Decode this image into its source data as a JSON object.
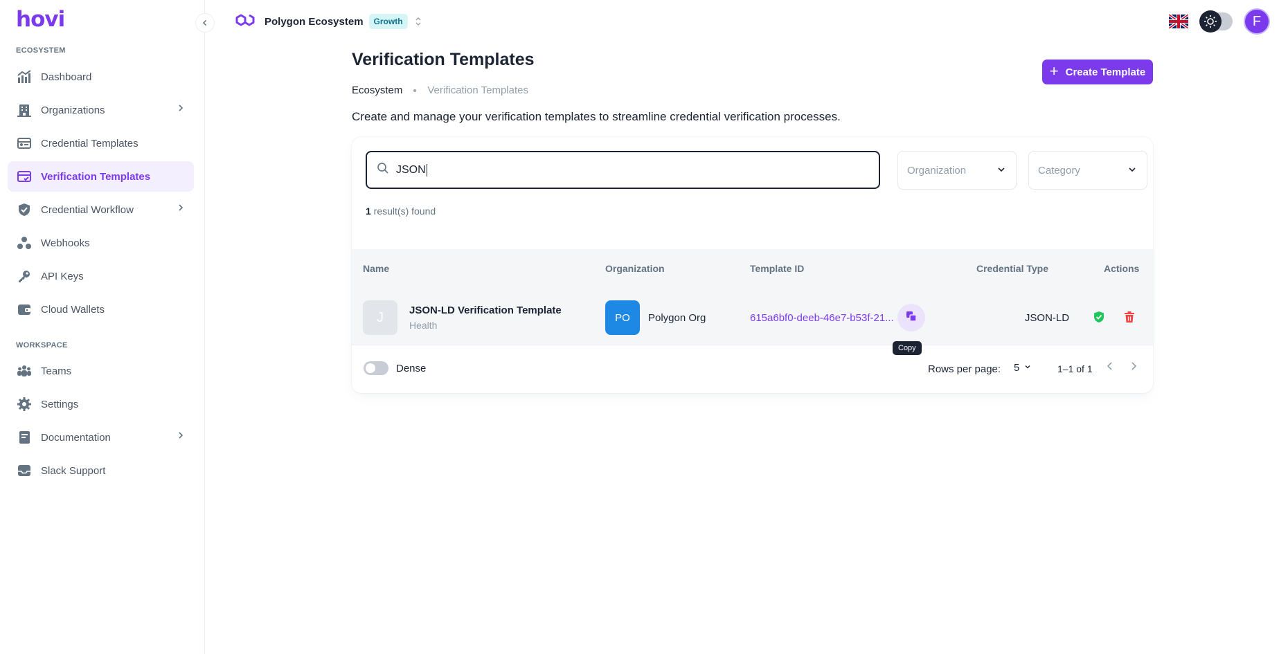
{
  "brand": {
    "logo_text": "hovi",
    "accent": "#7c3aed"
  },
  "sidebar": {
    "sections": [
      {
        "label": "ECOSYSTEM"
      },
      {
        "label": "WORKSPACE"
      }
    ],
    "items": [
      {
        "label": "Dashboard",
        "icon": "chart-icon"
      },
      {
        "label": "Organizations",
        "icon": "building-icon",
        "has_children": true
      },
      {
        "label": "Credential Templates",
        "icon": "credential-card-icon"
      },
      {
        "label": "Verification Templates",
        "icon": "verify-card-icon",
        "active": true
      },
      {
        "label": "Credential Workflow",
        "icon": "shield-check-icon",
        "has_children": true
      },
      {
        "label": "Webhooks",
        "icon": "webhook-icon"
      },
      {
        "label": "API Keys",
        "icon": "key-icon"
      },
      {
        "label": "Cloud Wallets",
        "icon": "wallet-icon"
      },
      {
        "label": "Teams",
        "icon": "people-icon"
      },
      {
        "label": "Settings",
        "icon": "gear-icon"
      },
      {
        "label": "Documentation",
        "icon": "book-icon",
        "has_children": true
      },
      {
        "label": "Slack Support",
        "icon": "inbox-icon"
      }
    ]
  },
  "topbar": {
    "ecosystem_name": "Polygon Ecosystem",
    "plan_badge": "Growth",
    "avatar_initial": "F"
  },
  "page": {
    "title": "Verification Templates",
    "breadcrumb": [
      "Ecosystem",
      "Verification Templates"
    ],
    "description": "Create and manage your verification templates to streamline credential verification processes.",
    "create_button": "Create Template"
  },
  "filters": {
    "search_value": "JSON",
    "organization_placeholder": "Organization",
    "category_placeholder": "Category",
    "results_count": "1",
    "results_suffix": " result(s) found"
  },
  "table": {
    "columns": [
      "Name",
      "Organization",
      "Template ID",
      "Credential Type",
      "Actions"
    ],
    "rows": [
      {
        "avatar_letter": "J",
        "name": "JSON-LD Verification Template",
        "category": "Health",
        "org_initials": "PO",
        "org_name": "Polygon Org",
        "template_id": "615a6bf0-deeb-46e7-b53f-21...",
        "credential_type": "JSON-LD"
      }
    ],
    "copy_tooltip": "Copy"
  },
  "footer": {
    "dense_label": "Dense",
    "rows_per_page_label": "Rows per page:",
    "rows_per_page_value": "5",
    "page_range": "1–1 of 1"
  }
}
